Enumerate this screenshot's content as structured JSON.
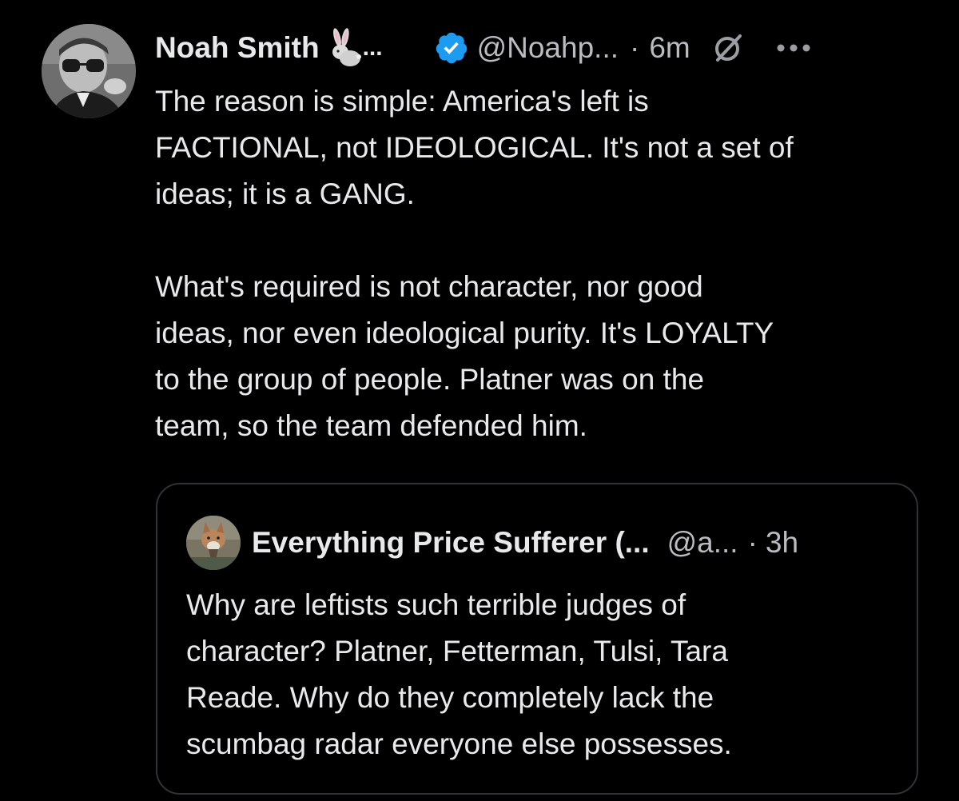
{
  "tweet": {
    "author": {
      "display_name": "Noah Smith",
      "name_emoji_icon": "rabbit-emoji-icon",
      "name_truncation": "...",
      "handle": "@Noahp...",
      "verified_icon": "verified-badge-icon",
      "verified_color": "#1d9bf0"
    },
    "separator": "·",
    "time": "6m",
    "action_icons": [
      "grok-icon",
      "more-options-icon"
    ],
    "text": "The reason is simple: America's left is\nFACTIONAL, not IDEOLOGICAL. It's not a set of\nideas; it is a GANG.\n\nWhat's required is not character, nor good\nideas, nor even ideological purity. It's LOYALTY\nto the group of people. Platner was on the\nteam, so the team defended him."
  },
  "quote": {
    "author": {
      "display_name": "Everything Price Sufferer (...",
      "handle": "@a..."
    },
    "separator": "·",
    "time": "3h",
    "text": "Why are leftists such terrible judges of\ncharacter? Platner, Fetterman, Tulsi, Tara\nReade. Why do they completely lack the\nscumbag radar everyone else possesses."
  },
  "colors": {
    "background": "#000000",
    "primary_text": "#e7e9ea",
    "secondary_text": "#b9bcc0",
    "border": "#2f3336",
    "accent": "#1d9bf0"
  }
}
